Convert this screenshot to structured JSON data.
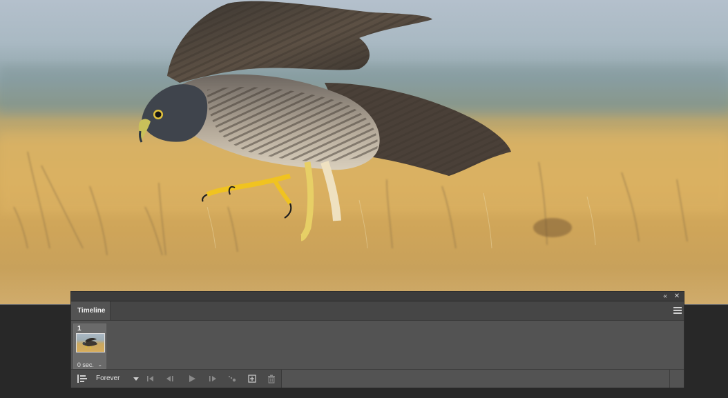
{
  "window": {
    "collapse_glyph": "«",
    "close_glyph": "✕"
  },
  "timeline_panel": {
    "tab_label": "Timeline",
    "menu_icon": "hamburger-menu-icon"
  },
  "frames": [
    {
      "number": "1",
      "delay": "0 sec."
    }
  ],
  "controls": {
    "loop_option": "Forever",
    "icons": [
      "convert-to-video-timeline-icon",
      "first-frame-icon",
      "previous-frame-icon",
      "play-icon",
      "next-frame-icon",
      "tween-icon",
      "duplicate-frame-icon",
      "delete-frame-icon"
    ]
  },
  "colors": {
    "panel_bg": "#535353",
    "titlebar_bg": "#3c3c3c",
    "workspace_bg": "#282828",
    "text_light": "#f0f0f0",
    "icon_gray": "#8a8a8a"
  }
}
